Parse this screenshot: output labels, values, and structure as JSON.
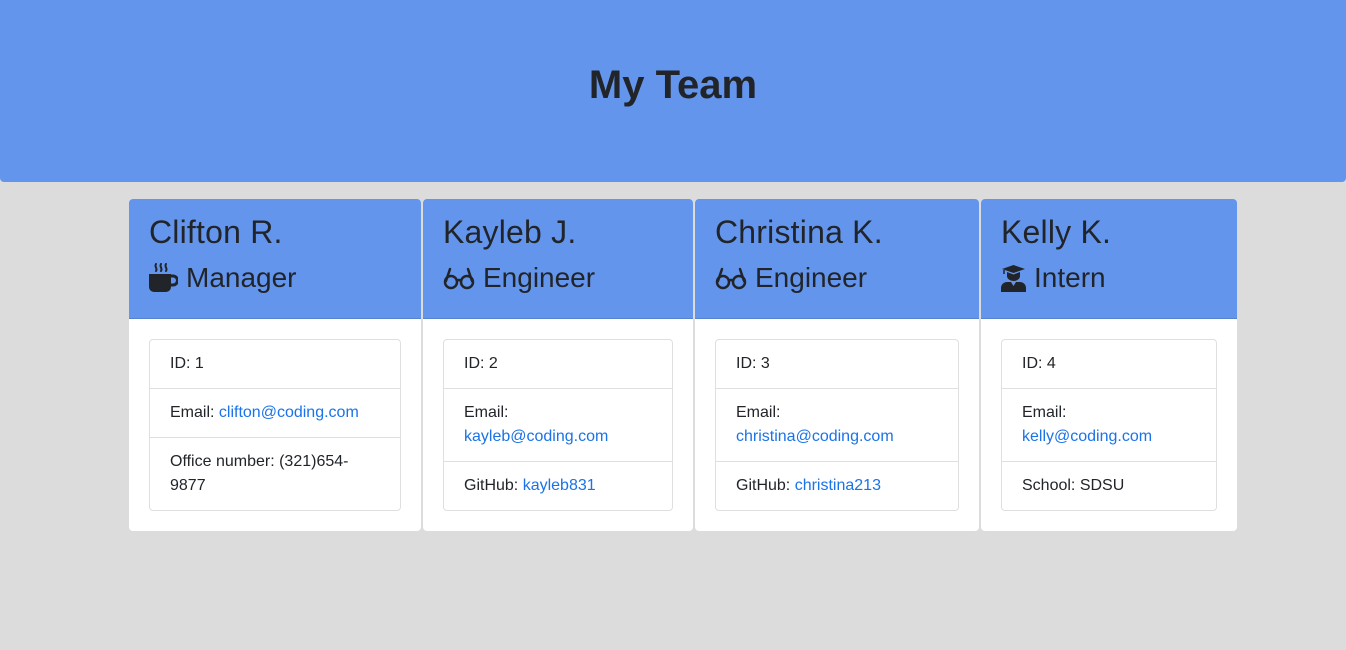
{
  "header": {
    "title": "My Team"
  },
  "cards": [
    {
      "name": "Clifton R.",
      "role": "Manager",
      "role_icon": "mug-hot-icon",
      "id_label": "ID:",
      "id": "1",
      "email_label": "Email:",
      "email": "clifton@coding.com",
      "extra_label": "Office number:",
      "extra_value_1": "(321)654-",
      "extra_value_2": "9877"
    },
    {
      "name": "Kayleb J.",
      "role": "Engineer",
      "role_icon": "glasses-icon",
      "id_label": "ID:",
      "id": "2",
      "email_label": "Email:",
      "email": "kayleb@coding.com",
      "extra_label": "GitHub:",
      "extra_value": "kayleb831"
    },
    {
      "name": "Christina K.",
      "role": "Engineer",
      "role_icon": "glasses-icon",
      "id_label": "ID:",
      "id": "3",
      "email_label": "Email:",
      "email": "christina@coding.com",
      "extra_label": "GitHub:",
      "extra_value": "christina213"
    },
    {
      "name": "Kelly K.",
      "role": "Intern",
      "role_icon": "user-graduate-icon",
      "id_label": "ID:",
      "id": "4",
      "email_label": "Email:",
      "email": "kelly@coding.com",
      "extra_label": "School:",
      "extra_value": "SDSU"
    }
  ],
  "colors": {
    "header_bg": "#6495ed",
    "page_bg": "#dcdcdc",
    "link": "#1a73e8"
  }
}
